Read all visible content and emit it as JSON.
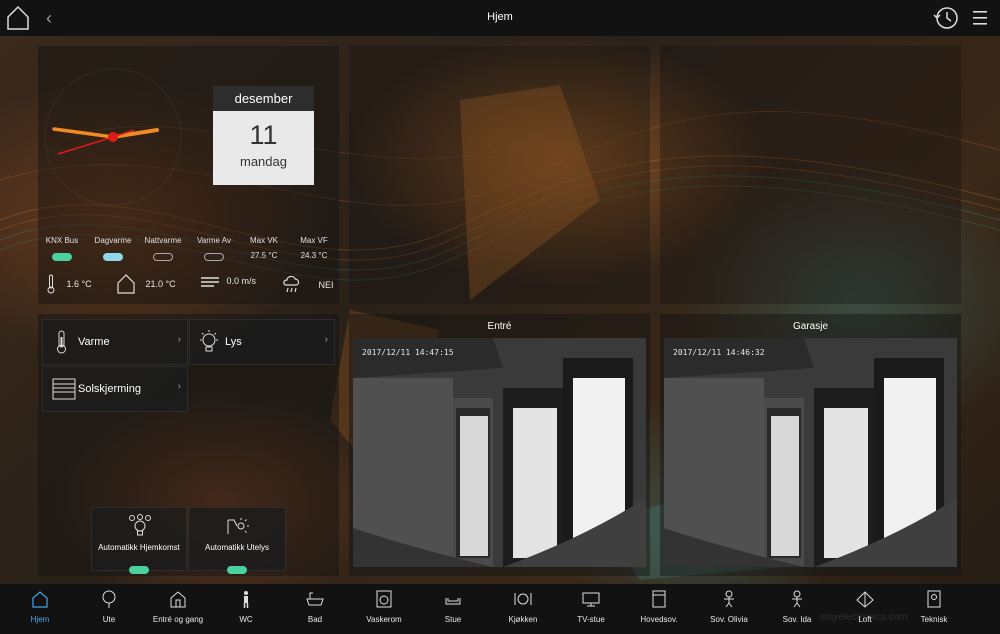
{
  "topbar": {
    "title": "Hjem",
    "back_glyph": "‹"
  },
  "calendar": {
    "month": "desember",
    "day": "11",
    "weekday": "mandag"
  },
  "status": [
    {
      "label": "KNX Bus",
      "state": "green"
    },
    {
      "label": "Dagvarme",
      "state": "cyan"
    },
    {
      "label": "Nattvarme",
      "state": "off"
    },
    {
      "label": "Varme Av",
      "state": "off"
    },
    {
      "label": "Max VK",
      "value": "27.5 °C"
    },
    {
      "label": "Max VF",
      "value": "24.3 °C"
    }
  ],
  "weather": {
    "outdoor_temp": "1.6 °C",
    "indoor_temp": "21.0 °C",
    "wind": "0.0 m/s",
    "rain": "NEI"
  },
  "tiles": {
    "varme": "Varme",
    "lys": "Lys",
    "solskjerming": "Solskjerming",
    "chevron": "›"
  },
  "automation": {
    "hjemkomst": "Automatikk Hjemkomst",
    "utelys": "Automatikk Utelys"
  },
  "cameras": [
    {
      "title": "Entré",
      "timestamp": "2017/12/11  14:47:15"
    },
    {
      "title": "Garasje",
      "timestamp": "2017/12/11  14:46:32"
    }
  ],
  "bottom_nav": [
    "Hjem",
    "Ute",
    "Entré og gang",
    "WC",
    "Bad",
    "Vaskerom",
    "Stue",
    "Kjøkken",
    "TV-stue",
    "Hovedsov.",
    "Sov. Olivia",
    "Sov. Ida",
    "Loft",
    "Teknisk"
  ],
  "watermark": "stayelectronics.com",
  "colors": {
    "active": "#4aa3e8",
    "pill_green": "#4bd0a0",
    "pill_cyan": "#8fd8ea",
    "clock_hand": "#f08a24",
    "clock_second": "#e01a1a"
  }
}
